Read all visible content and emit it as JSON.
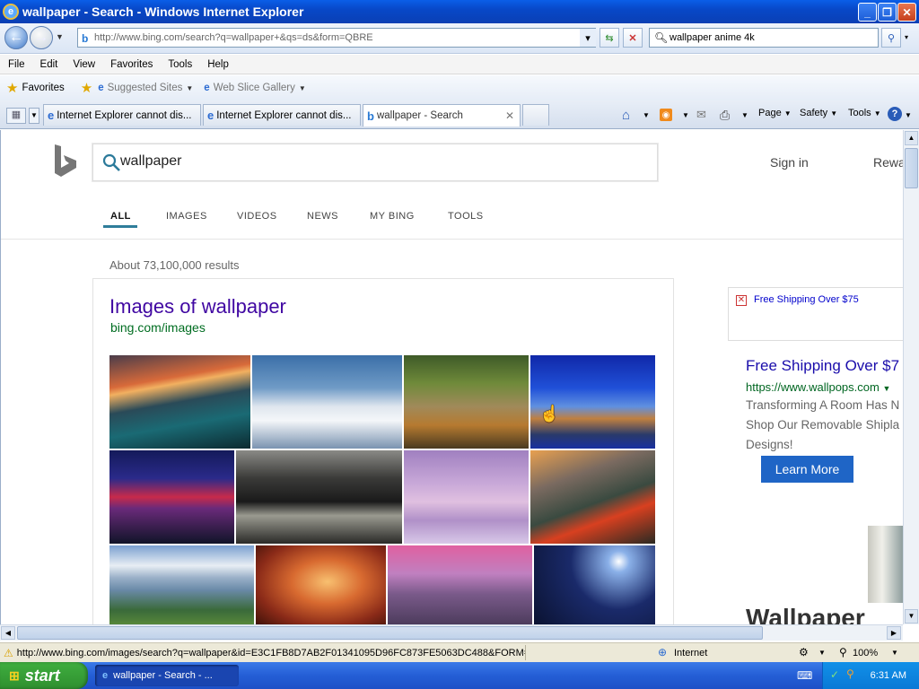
{
  "window": {
    "title": "wallpaper - Search - Windows Internet Explorer"
  },
  "navbar": {
    "address": "http://www.bing.com/search?q=wallpaper+&qs=ds&form=QBRE",
    "search_value": "wallpaper anime 4k"
  },
  "menu": [
    "File",
    "Edit",
    "View",
    "Favorites",
    "Tools",
    "Help"
  ],
  "favorites_bar": {
    "favorites_label": "Favorites",
    "suggested_sites": "Suggested Sites",
    "web_slice_gallery": "Web Slice Gallery"
  },
  "tabs": [
    {
      "label": "Internet Explorer cannot dis...",
      "active": false
    },
    {
      "label": "Internet Explorer cannot dis...",
      "active": false
    },
    {
      "label": "wallpaper - Search",
      "active": true
    }
  ],
  "command_bar": {
    "page": "Page",
    "safety": "Safety",
    "tools": "Tools"
  },
  "bing": {
    "query": "wallpaper",
    "sign_in": "Sign in",
    "rewards": "Rewa",
    "nav": [
      "ALL",
      "IMAGES",
      "VIDEOS",
      "NEWS",
      "MY BING",
      "TOOLS"
    ],
    "active_nav": "ALL",
    "result_count": "About 73,100,000 results",
    "images_title": "Images of wallpaper",
    "images_url": "bing.com/images",
    "ad_banner": "Free Shipping Over $75",
    "ad": {
      "title": "Free Shipping Over $7",
      "url": "https://www.wallpops.com",
      "lines": [
        "Transforming A Room Has N",
        "Shop Our Removable Shipla",
        "Designs!"
      ],
      "button": "Learn More"
    },
    "bottom_heading": "Wallpaper"
  },
  "status": {
    "url": "http://www.bing.com/images/search?q=wallpaper&id=E3C1FB8D7AB2F01341095D96FC873FE5063DC488&FORM=I(",
    "zone": "Internet",
    "zoom": "100%"
  },
  "taskbar": {
    "start": "start",
    "task": "wallpaper - Search - ...",
    "clock": "6:31 AM"
  },
  "colors": {
    "title_blue": "#0a4fd0",
    "bing_link": "#4007a2",
    "bing_green": "#006d21",
    "learn_more": "#1f65c6"
  }
}
